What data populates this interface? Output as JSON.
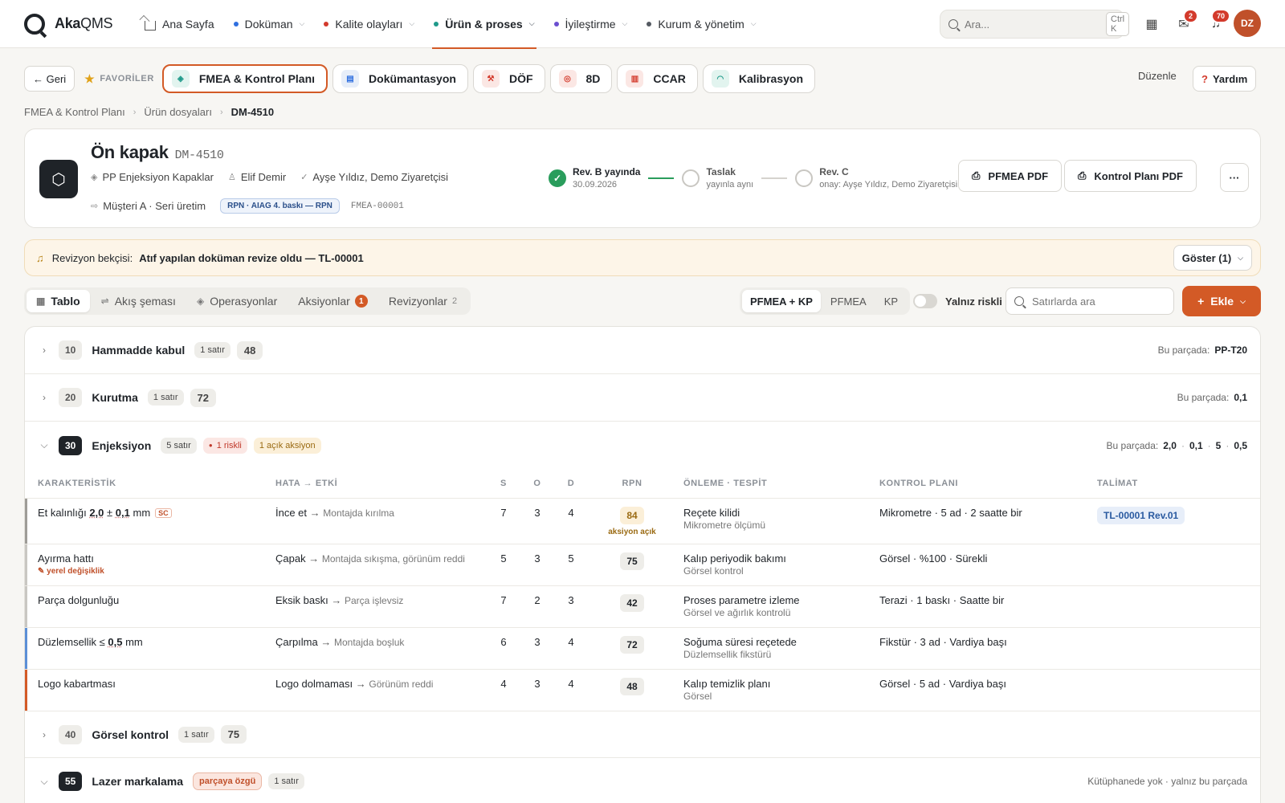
{
  "app": {
    "brand_bold": "Aka",
    "brand_rest": "QMS"
  },
  "nav": [
    {
      "label": "Ana Sayfa",
      "dot": null,
      "icon": "home-icon"
    },
    {
      "label": "Doküman",
      "dot": "#2f6fe0"
    },
    {
      "label": "Kalite olayları",
      "dot": "#d33a2c"
    },
    {
      "label": "Ürün & proses",
      "dot": "#1f9a8a",
      "active": true
    },
    {
      "label": "İyileştirme",
      "dot": "#6b4fd0"
    },
    {
      "label": "Kurum & yönetim",
      "dot": "#555a62"
    }
  ],
  "search": {
    "placeholder": "Ara...",
    "shortcut": "Ctrl K"
  },
  "notifications": {
    "inbox_count": "2",
    "bell_count": "70"
  },
  "user": {
    "initials": "DZ"
  },
  "favbar": {
    "back": "← Geri",
    "fav_label": "FAVORİLER",
    "items": [
      {
        "label": "FMEA & Kontrol Planı",
        "icon": "layers-icon",
        "active": true
      },
      {
        "label": "Dokümantasyon",
        "icon": "document-icon"
      },
      {
        "label": "DÖF",
        "icon": "wrench-icon"
      },
      {
        "label": "8D",
        "icon": "target-icon"
      },
      {
        "label": "CCAR",
        "icon": "clipboard-icon"
      },
      {
        "label": "Kalibrasyon",
        "icon": "gauge-icon"
      }
    ],
    "edit": "Düzenle",
    "help": "Yardım"
  },
  "breadcrumb": [
    "FMEA & Kontrol Planı",
    "Ürün dosyaları",
    "DM-4510"
  ],
  "header": {
    "title": "Ön kapak",
    "code": "DM-4510",
    "family": "PP Enjeksiyon Kapaklar",
    "owner": "Elif Demir",
    "approvers": "Ayşe Yıldız, Demo Ziyaretçisi",
    "customer": "Müşteri A · Seri üretim",
    "rpn_badge": "RPN · AIAG 4. baskı — RPN",
    "fmea_code": "FMEA-00001",
    "revisions": [
      {
        "title": "Rev. B yayında",
        "sub": "30.09.2026",
        "state": "done"
      },
      {
        "title": "Taslak",
        "sub": "yayınla aynı",
        "state": "open"
      },
      {
        "title": "Rev. C",
        "sub": "onay: Ayşe Yıldız, Demo Ziyaretçisi",
        "state": "open"
      }
    ],
    "pfmea_pdf": "PFMEA PDF",
    "kp_pdf": "Kontrol Planı PDF",
    "more": "···"
  },
  "alert": {
    "label": "Revizyon bekçisi:",
    "message": "Atıf yapılan doküman revize oldu — TL-00001",
    "button": "Göster (1)"
  },
  "view_tabs": [
    {
      "label": "Tablo",
      "active": true
    },
    {
      "label": "Akış şeması"
    },
    {
      "label": "Operasyonlar"
    },
    {
      "label": "Aksiyonlar",
      "count": "1"
    },
    {
      "label": "Revizyonlar",
      "count": "2"
    }
  ],
  "mode_tabs": [
    {
      "label": "PFMEA + KP",
      "active": true
    },
    {
      "label": "PFMEA"
    },
    {
      "label": "KP"
    }
  ],
  "risky_toggle": "Yalnız riskli",
  "row_search": {
    "placeholder": "Satırlarda ara"
  },
  "add_button": "Ekle",
  "groups": [
    {
      "num": "10",
      "name": "Hammadde kabul",
      "rows": "1 satır",
      "rpn": "48",
      "right_label": "Bu parçada:",
      "right_value": "PP-T20"
    },
    {
      "num": "20",
      "name": "Kurutma",
      "rows": "1 satır",
      "rpn": "72",
      "right_label": "Bu parçada:",
      "right_value": "0,1"
    },
    {
      "num": "30",
      "name": "Enjeksiyon",
      "rows": "5 satır",
      "risky": "1 riskli",
      "action": "1 açık aksiyon",
      "right_label": "Bu parçada:",
      "right_values": [
        "2,0",
        "0,1",
        "5",
        "0,5"
      ]
    },
    {
      "num": "40",
      "name": "Görsel kontrol",
      "rows": "1 satır",
      "rpn": "75"
    },
    {
      "num": "55",
      "name": "Lazer markalama",
      "tag": "parçaya özgü",
      "rows": "1 satır",
      "right_note": "Kütüphanede yok · yalnız bu parçada"
    }
  ],
  "columns": [
    "KARAKTERİSTİK",
    "HATA → ETKİ",
    "S",
    "O",
    "D",
    "RPN",
    "ÖNLEME · TESPİT",
    "KONTROL PLANI",
    "TALİMAT"
  ],
  "rows": [
    {
      "char": "Et kalınlığı",
      "spec": [
        "2,0",
        "±",
        "0,1",
        "mm"
      ],
      "sc": "SC",
      "failure": "İnce et",
      "effect": "Montajda kırılma",
      "s": "7",
      "o": "3",
      "d": "4",
      "rpn": "84",
      "rpn_note": "aksiyon açık",
      "prevention": "Reçete kilidi",
      "detection": "Mikrometre ölçümü",
      "cp": "Mikrometre · 5 ad · 2 saatte bir",
      "instruction": "TL-00001 Rev.01",
      "accent": "#9e9c97"
    },
    {
      "char": "Ayırma hattı",
      "note": "✎ yerel değişiklik",
      "failure": "Çapak",
      "effect": "Montajda sıkışma, görünüm reddi",
      "s": "5",
      "o": "3",
      "d": "5",
      "rpn": "75",
      "prevention": "Kalıp periyodik bakımı",
      "detection": "Görsel kontrol",
      "cp": "Görsel · %100 · Sürekli",
      "accent": "#c9c7c2"
    },
    {
      "char": "Parça dolgunluğu",
      "failure": "Eksik baskı",
      "effect": "Parça işlevsiz",
      "s": "7",
      "o": "2",
      "d": "3",
      "rpn": "42",
      "prevention": "Proses parametre izleme",
      "detection": "Görsel ve ağırlık kontrolü",
      "cp": "Terazi · 1 baskı · Saatte bir",
      "accent": "#c9c7c2"
    },
    {
      "char": "Düzlemsellik",
      "spec": [
        "≤",
        "0,5",
        "mm"
      ],
      "failure": "Çarpılma",
      "effect": "Montajda boşluk",
      "s": "6",
      "o": "3",
      "d": "4",
      "rpn": "72",
      "prevention": "Soğuma süresi reçetede",
      "detection": "Düzlemsellik fikstürü",
      "cp": "Fikstür · 3 ad · Vardiya başı",
      "accent": "#5b8fd6"
    },
    {
      "char": "Logo kabartması",
      "failure": "Logo dolmaması",
      "effect": "Görünüm reddi",
      "s": "4",
      "o": "3",
      "d": "4",
      "rpn": "48",
      "prevention": "Kalıp temizlik planı",
      "detection": "Görsel",
      "cp": "Görsel · 5 ad · Vardiya başı",
      "accent": "#d35a26"
    }
  ]
}
